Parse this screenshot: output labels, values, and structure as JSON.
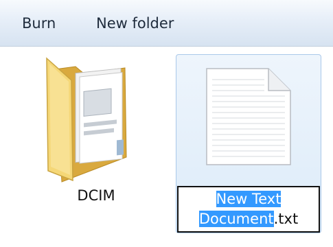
{
  "toolbar": {
    "burn_label": "Burn",
    "new_folder_label": "New folder"
  },
  "items": {
    "folder": {
      "name": "DCIM",
      "icon": "folder-icon"
    },
    "file": {
      "name_line1": "New Text",
      "name_line2_selected": "Document",
      "name_extension": ".txt",
      "icon": "text-document-icon"
    }
  },
  "colors": {
    "toolbar_gradient": [
      "#f7fafd",
      "#d7e3f1"
    ],
    "selection_highlight": "#3399ff",
    "selected_item_bg": "#dcebf9"
  }
}
